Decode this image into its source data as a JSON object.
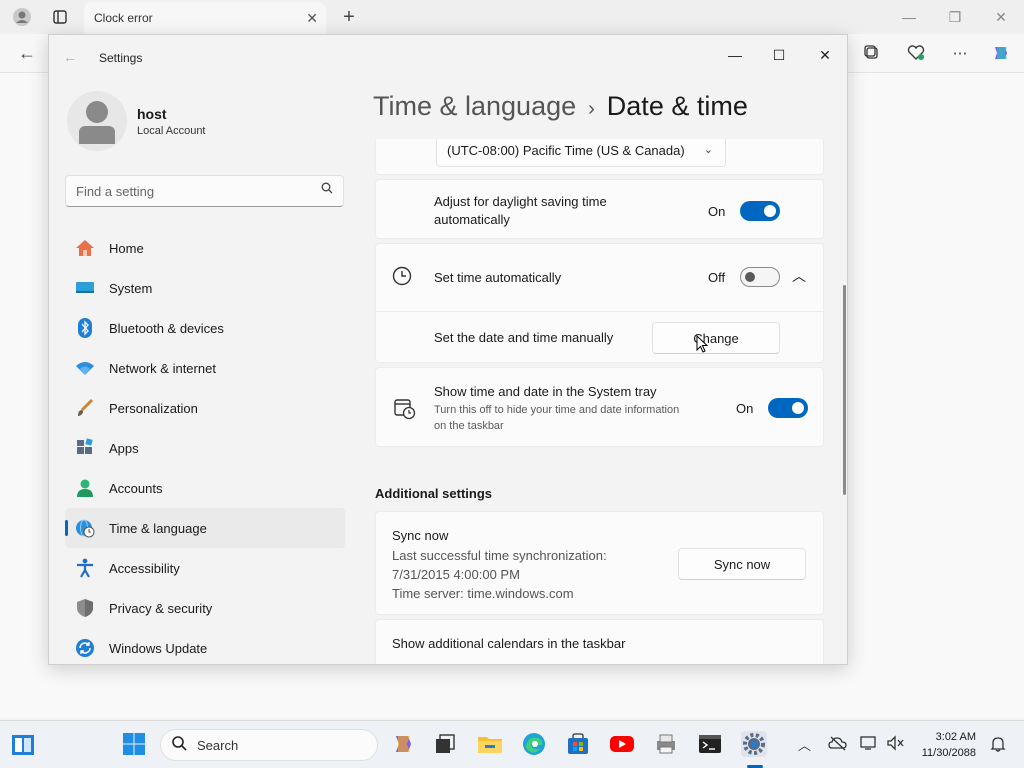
{
  "browser": {
    "tab_title": "Clock error",
    "tab_close": "✕",
    "new_tab": "+"
  },
  "settings": {
    "window_title": "Settings",
    "profile": {
      "name": "host",
      "account_type": "Local Account"
    },
    "search_placeholder": "Find a setting",
    "nav": [
      {
        "label": "Home",
        "icon": "home-icon"
      },
      {
        "label": "System",
        "icon": "system-icon"
      },
      {
        "label": "Bluetooth & devices",
        "icon": "bluetooth-icon"
      },
      {
        "label": "Network & internet",
        "icon": "wifi-icon"
      },
      {
        "label": "Personalization",
        "icon": "brush-icon"
      },
      {
        "label": "Apps",
        "icon": "apps-icon"
      },
      {
        "label": "Accounts",
        "icon": "accounts-icon"
      },
      {
        "label": "Time & language",
        "icon": "globe-clock-icon",
        "active": true
      },
      {
        "label": "Accessibility",
        "icon": "accessibility-icon"
      },
      {
        "label": "Privacy & security",
        "icon": "shield-icon"
      },
      {
        "label": "Windows Update",
        "icon": "update-icon"
      }
    ],
    "breadcrumb": {
      "parent": "Time & language",
      "separator": "›",
      "current": "Date & time"
    },
    "timezone_value": "(UTC-08:00) Pacific Time (US & Canada)",
    "daylight": {
      "label_line1": "Adjust for daylight saving time",
      "label_line2": "automatically",
      "state": "On"
    },
    "set_time_auto": {
      "label": "Set time automatically",
      "state": "Off"
    },
    "manual": {
      "label": "Set the date and time manually",
      "button": "Change"
    },
    "tray": {
      "label": "Show time and date in the System tray",
      "desc_line1": "Turn this off to hide your time and date information",
      "desc_line2": "on the taskbar",
      "state": "On"
    },
    "additional_title": "Additional settings",
    "sync": {
      "title": "Sync now",
      "line1": "Last successful time synchronization:",
      "line2": "7/31/2015 4:00:00 PM",
      "line3": "Time server: time.windows.com",
      "button": "Sync now"
    },
    "calendars_label": "Show additional calendars in the taskbar"
  },
  "taskbar": {
    "search_placeholder": "Search",
    "time": "3:02 AM",
    "date": "11/30/2088"
  },
  "colors": {
    "accent": "#0067c0"
  }
}
